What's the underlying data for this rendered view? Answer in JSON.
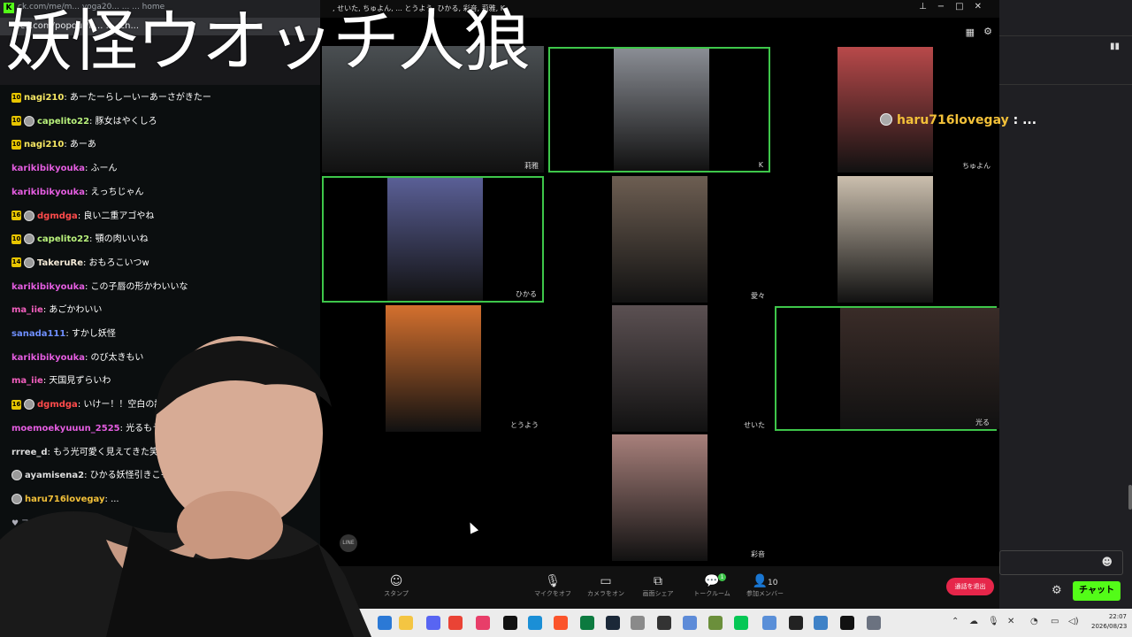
{
  "overlay_title": "妖怪ウオッチ人狼",
  "browser": {
    "tab_url": "ck.com/me/m... yoga20... ... ... home",
    "popout_url": "ick.com/popout/h... ... /ch..."
  },
  "chat": {
    "messages": [
      {
        "badge": "10",
        "user": "nagi210",
        "color": "#f5e663",
        "text": "あーたーらしーいーあーさがきたー",
        "avatar": false
      },
      {
        "badge": "10",
        "user": "capelito22",
        "color": "#b9f27c",
        "text": "豚女はやくしろ",
        "avatar": true
      },
      {
        "badge": "10",
        "user": "nagi210",
        "color": "#f5e663",
        "text": "あーあ",
        "avatar": false
      },
      {
        "badge": "",
        "user": "karikibikyouka",
        "color": "#e45de0",
        "text": "ふーん",
        "avatar": false
      },
      {
        "badge": "",
        "user": "karikibikyouka",
        "color": "#e45de0",
        "text": "えっちじゃん",
        "avatar": false
      },
      {
        "badge": "16",
        "user": "dgmdga",
        "color": "#ff4b4b",
        "text": "良い二重アゴやね",
        "avatar": true
      },
      {
        "badge": "10",
        "user": "capelito22",
        "color": "#b9f27c",
        "text": "顎の肉いいね",
        "avatar": true
      },
      {
        "badge": "14",
        "user": "TakeruRe",
        "color": "#f3e9d6",
        "text": "おもろこいつw",
        "avatar": true
      },
      {
        "badge": "",
        "user": "karikibikyouka",
        "color": "#e45de0",
        "text": "この子唇の形かわいいな",
        "avatar": false
      },
      {
        "badge": "",
        "user": "ma_iie",
        "color": "#f25fbe",
        "text": "あごかわいい",
        "avatar": false
      },
      {
        "badge": "",
        "user": "sanada111",
        "color": "#6f8fff",
        "text": "すかし妖怪",
        "avatar": false
      },
      {
        "badge": "",
        "user": "karikibikyouka",
        "color": "#e45de0",
        "text": "のび太きもい",
        "avatar": false
      },
      {
        "badge": "",
        "user": "ma_iie",
        "color": "#f25fbe",
        "text": "天国見ずらいわ",
        "avatar": false
      },
      {
        "badge": "16",
        "user": "dgmdga",
        "color": "#ff4b4b",
        "text": "いけー！！空白の論争中",
        "avatar": true
      },
      {
        "badge": "",
        "user": "moemoekyuuun_2525",
        "color": "#e45de0",
        "text": "光るもう妖怪ば",
        "avatar": false
      },
      {
        "badge": "",
        "user": "rrree_d",
        "color": "#dddddd",
        "text": "もう光可愛く見えてきた笑笑",
        "avatar": false
      },
      {
        "badge": "",
        "user": "ayamisena2",
        "color": "#dddddd",
        "text": "ひかる妖怪引きこもり",
        "avatar": true
      },
      {
        "badge": "",
        "user": "haru716lovegay",
        "color": "#f2c039",
        "text": "...",
        "avatar": true
      }
    ],
    "followers_only": "♥ フォロワーのみ",
    "send_label": "チャット"
  },
  "meeting": {
    "participants_line": ", せいた, ちゅよん, ... とうよう, ひかる, 彩音, 莉雅, K",
    "tiles": [
      {
        "name": "莉雅",
        "active": false,
        "color": "#4a4f52"
      },
      {
        "name": "K",
        "active": true,
        "color": "#8a8d94"
      },
      {
        "name": "ちゅよん",
        "active": false,
        "color": "#b8494a"
      },
      {
        "name": "ひかる",
        "active": true,
        "color": "#5a5f96"
      },
      {
        "name": "愛々",
        "active": false,
        "color": "#6d5e52"
      },
      {
        "name": "",
        "active": false,
        "color": "#cbbfae"
      },
      {
        "name": "とうよう",
        "active": false,
        "color": "#d4702e"
      },
      {
        "name": "せいた",
        "active": false,
        "color": "#5b5052"
      },
      {
        "name": "光る",
        "active": true,
        "color": "#3a2c28"
      },
      {
        "name": "彩音",
        "active": false,
        "color": "#a8807b"
      }
    ],
    "buttons": [
      {
        "label": "スタンプ",
        "icon": "☺"
      },
      {
        "label": "マイクをオフ",
        "icon": "🎙"
      },
      {
        "label": "カメラをオン",
        "icon": "▭"
      },
      {
        "label": "画面シェア",
        "icon": "⧉"
      },
      {
        "label": "トークルーム",
        "icon": "💬"
      },
      {
        "label": "参加メンバー",
        "icon": "👤",
        "count": "10"
      }
    ],
    "talk_badge": "1",
    "leave_label": "通話を退出",
    "haru_user": "haru716lovegay",
    "haru_text": " : ..."
  },
  "taskbar": {
    "time": "22:07",
    "date": "2026/08/23"
  }
}
